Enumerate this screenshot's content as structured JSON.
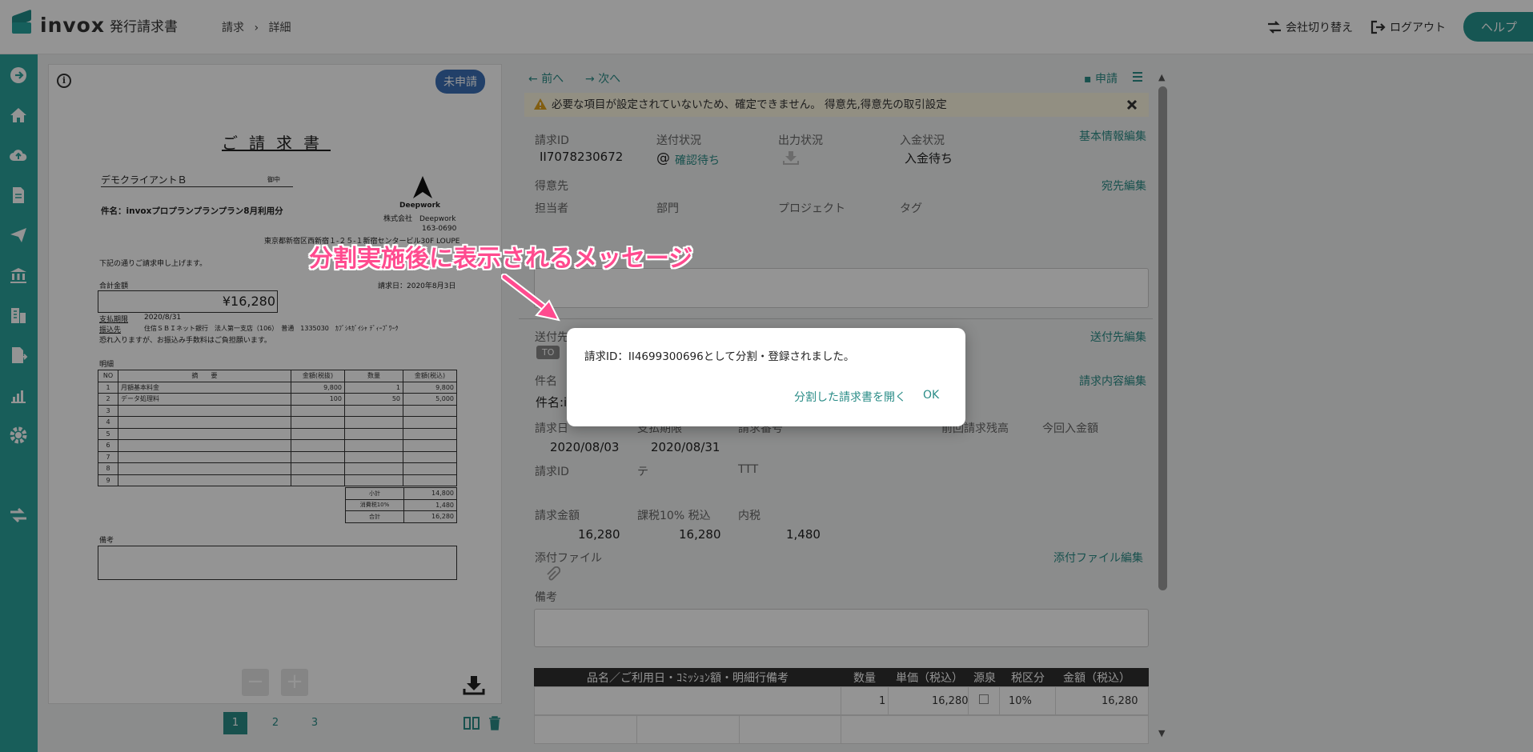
{
  "header": {
    "logo_text": "invox",
    "logo_sub": "発行請求書",
    "breadcrumb": [
      "請求",
      "詳細"
    ],
    "switch_company": "会社切り替え",
    "logout": "ログアウト",
    "help": "ヘルプ"
  },
  "preview": {
    "status_badge": "未申請",
    "title": "ご請求書",
    "client": "デモクライアントＢ",
    "honorific": "御中",
    "subject": "件名：invoxプロプランプランプラン8月利用分",
    "company_logo": "Deepwork",
    "company_name": "株式会社　Deepwork",
    "postal": "163-0690",
    "address": "東京都新宿区西新宿１-２５-１新宿センタービル30F LOUPE",
    "greeting": "下記の通りご請求申し上げます。",
    "total_label": "合計金額",
    "issue_date": "請求日：2020年8月3日",
    "total": "¥16,280",
    "due_label": "支払期限",
    "due_date": "2020/8/31",
    "bank_label": "振込先",
    "bank": "住信ＳＢＩネット銀行　法人第一支店（106）　普通　1335030　ｶﾌﾞｼｷｶﾞｲｼｬ ﾃﾞｨｰﾌﾟﾜｰｸ",
    "fee_note": "恐れ入りますが、お振込み手数料はご負担願います。",
    "detail_label": "明細",
    "table_headers": [
      "NO",
      "摘　　要",
      "金額(税抜)",
      "数量",
      "金額(税込)"
    ],
    "rows": [
      [
        "1",
        "月額基本料金",
        "9,800",
        "1",
        "9,800"
      ],
      [
        "2",
        "データ処理料",
        "100",
        "50",
        "5,000"
      ],
      [
        "3",
        "",
        "",
        "",
        ""
      ],
      [
        "4",
        "",
        "",
        "",
        ""
      ],
      [
        "5",
        "",
        "",
        "",
        ""
      ],
      [
        "6",
        "",
        "",
        "",
        ""
      ],
      [
        "7",
        "",
        "",
        "",
        ""
      ],
      [
        "8",
        "",
        "",
        "",
        ""
      ],
      [
        "9",
        "",
        "",
        "",
        ""
      ]
    ],
    "subtotal_label": "小計",
    "subtotal": "14,800",
    "tax_label": "消費税10%",
    "tax": "1,480",
    "sum_label": "合計",
    "sum": "16,280",
    "remarks_label": "備考",
    "pages": [
      "1",
      "2",
      "3"
    ]
  },
  "detail": {
    "prev": "前へ",
    "next": "次へ",
    "apply": "申請",
    "warning": "必要な項目が設定されていないため、確定できません。 得意先,得意先の取引設定",
    "invoice_id_label": "請求ID",
    "invoice_id": "II7078230672",
    "send_status_label": "送付状況",
    "send_status": "確認待ち",
    "output_status_label": "出力状況",
    "payment_status_label": "入金状況",
    "payment_status": "入金待ち",
    "edit_basic": "基本情報編集",
    "client_label": "得意先",
    "edit_recipient": "宛先編集",
    "person_label": "担当者",
    "dept_label": "部門",
    "project_label": "プロジェクト",
    "tag_label": "タグ",
    "sendto_label": "送付先",
    "sendto_tag": "TO",
    "edit_sendto": "送付先編集",
    "subject_label": "件名",
    "subject_value": "件名:i",
    "edit_content": "請求内容編集",
    "invoice_date_label": "請求日",
    "due_label": "支払期限",
    "invoice_no_label": "請求番号",
    "prev_balance_label": "前回請求残高",
    "this_payment_label": "今回入金額",
    "invoice_date": "2020/08/03",
    "due_date": "2020/08/31",
    "invoice_id2_label": "請求ID",
    "te": "テ",
    "ttt": "TTT",
    "amount_label": "請求金額",
    "taxed_label": "課税10% 税込",
    "inner_label": "内税",
    "amount": "16,280",
    "taxed": "16,280",
    "inner": "1,480",
    "attach_label": "添付ファイル",
    "edit_attach": "添付ファイル編集",
    "remarks_label": "備考",
    "grid_headers": [
      "品名／ご利用日・ｺﾐｯｼｮﾝ額・明細行備考",
      "数量",
      "単価（税込）",
      "源泉",
      "税区分",
      "金額（税込）"
    ],
    "grid_row": [
      "",
      "1",
      "16,280",
      "",
      "10%",
      "16,280"
    ]
  },
  "modal": {
    "message": "請求ID：II4699300696として分割・登録されました。",
    "open_button": "分割した請求書を開く",
    "ok_button": "OK"
  },
  "annotation": "分割実施後に表示されるメッセージ"
}
